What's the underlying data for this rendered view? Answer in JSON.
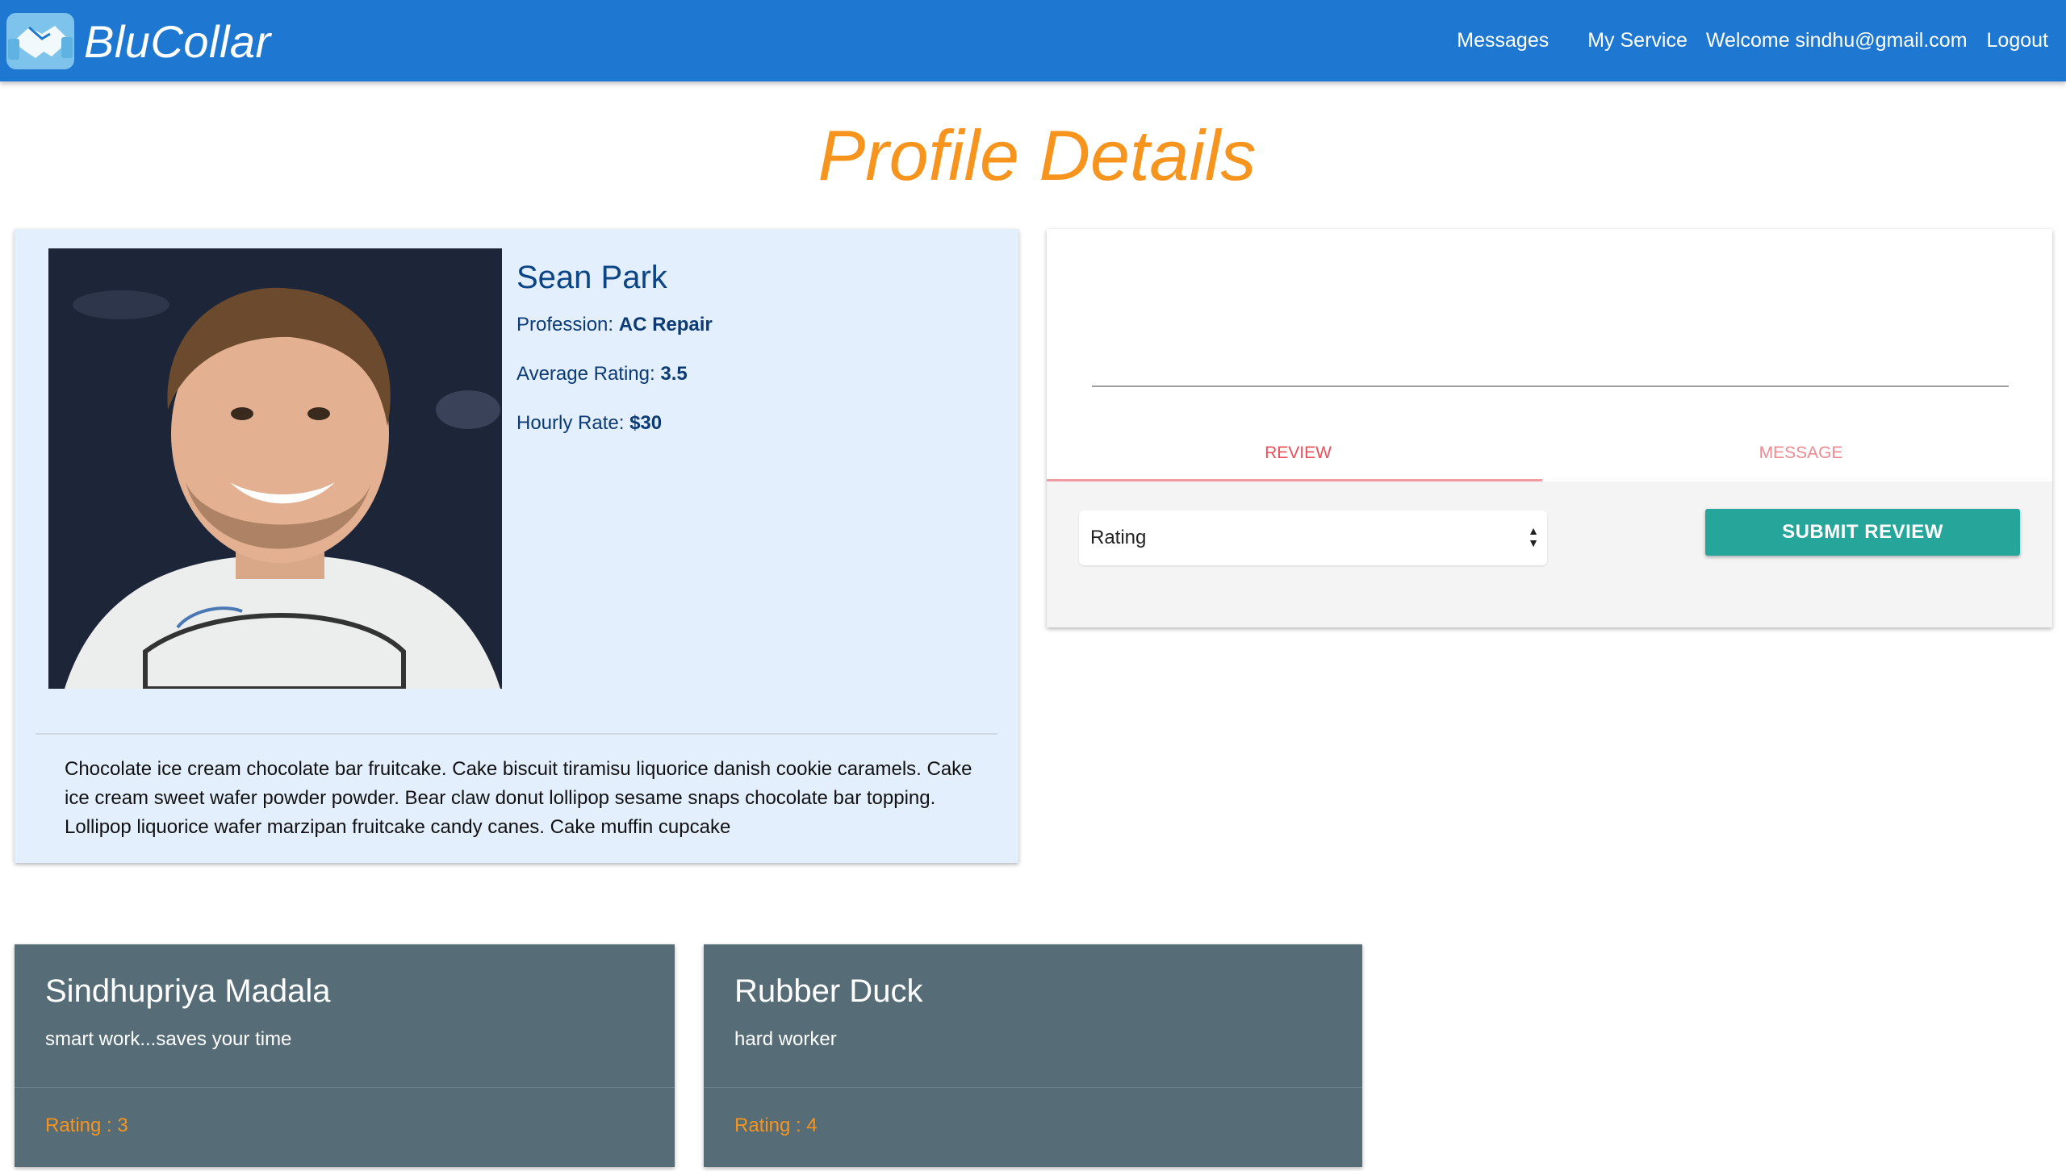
{
  "navbar": {
    "brand": "BluCollar",
    "logo_icon": "handshake-icon",
    "links": {
      "messages": "Messages",
      "my_service": "My Service",
      "welcome": "Welcome sindhu@gmail.com",
      "logout": "Logout"
    }
  },
  "page": {
    "title": "Profile Details"
  },
  "profile": {
    "name": "Sean Park",
    "profession_label": "Profession:",
    "profession": "AC Repair",
    "rating_label": "Average Rating:",
    "rating": "3.5",
    "rate_label": "Hourly Rate:",
    "rate": "$30",
    "bio": "Chocolate ice cream chocolate bar fruitcake. Cake biscuit tiramisu liquorice danish cookie caramels. Cake ice cream sweet wafer powder powder. Bear claw donut lollipop sesame snaps chocolate bar topping. Lollipop liquorice wafer marzipan fruitcake candy canes. Cake muffin cupcake"
  },
  "actions": {
    "text_value": "",
    "tabs": [
      "REVIEW",
      "MESSAGE"
    ],
    "active_tab": "REVIEW",
    "rating_select": {
      "selected": "Rating"
    },
    "submit_label": "SUBMIT REVIEW"
  },
  "reviews": [
    {
      "name": "Sindhupriya Madala",
      "text": "smart work...saves your time",
      "rating": "Rating : 3"
    },
    {
      "name": "Rubber Duck",
      "text": "hard worker",
      "rating": "Rating : 4"
    }
  ],
  "colors": {
    "navbar": "#1e78d2",
    "title": "#f7941d",
    "profile_card": "#e3effc",
    "submit": "#26a69a",
    "review_card": "#566d78",
    "tab_active": "#e8505b"
  }
}
